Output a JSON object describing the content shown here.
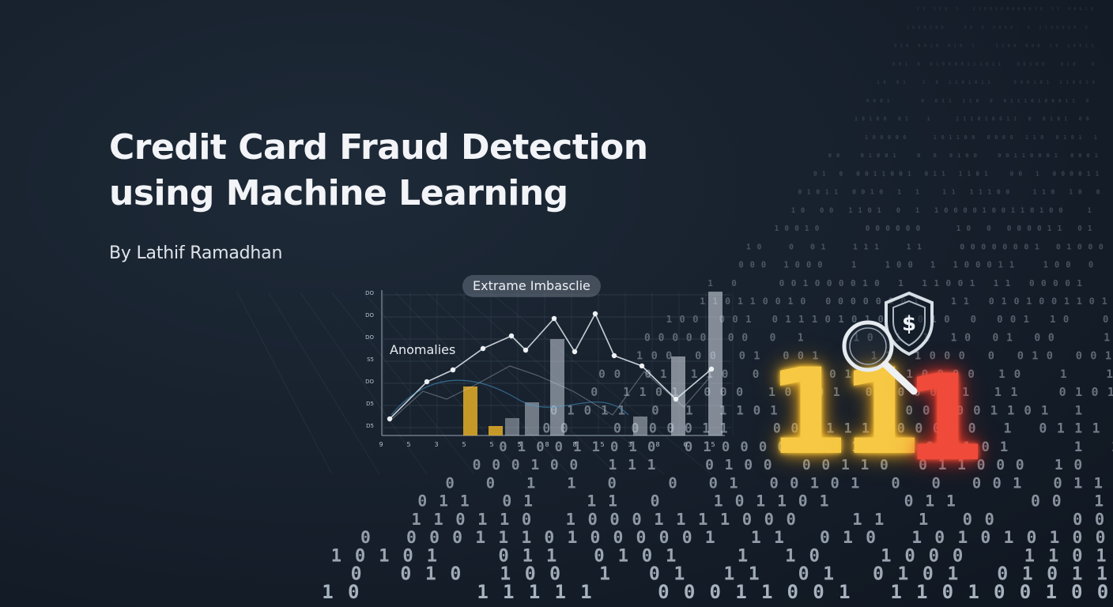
{
  "title_lines": [
    "Credit Card Fraud Detection",
    "using Machine Learning"
  ],
  "author": "By Lathif Ramadhan",
  "illustration": {
    "pill_label": "Extrame Imbasclie",
    "anomalies_label": "Anomalies",
    "y_tick_labels": [
      "DO",
      "DO",
      "DO",
      "S5",
      "DO",
      "D5",
      "D5"
    ],
    "x_tick_labels": [
      "9",
      "5",
      "3",
      "5",
      "5",
      "5",
      "8",
      "8",
      "5",
      "3",
      "8",
      "6",
      "5"
    ],
    "glow_digits": [
      {
        "char": "1",
        "color": "yellow"
      },
      {
        "char": "1",
        "color": "yellow"
      },
      {
        "char": "1",
        "color": "red"
      }
    ],
    "shield_symbol": "$",
    "icons": [
      "shield-dollar-icon",
      "magnifier-icon"
    ],
    "colors": {
      "background": "#161f2b",
      "text": "#f2f4f7",
      "bar_gold": "#d9a528",
      "bar_gray": "#c9d2dc",
      "glow_yellow": "#f6c844",
      "glow_red": "#f04a3a"
    }
  }
}
